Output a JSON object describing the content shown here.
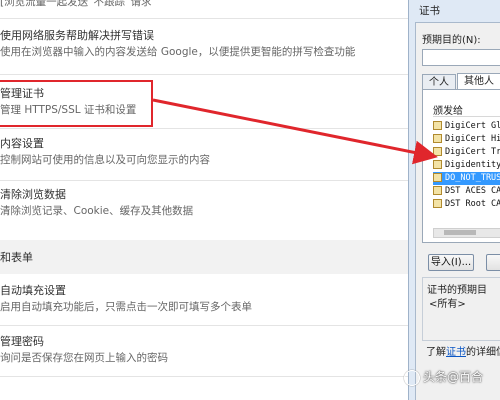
{
  "settings": {
    "top_fragment": "[浏览流量一起发送“不跟踪”请求",
    "spell": {
      "title": "使用网络服务帮助解决拼写错误",
      "desc": "使用在浏览器中输入的内容发送给 Google，以便提供更智能的拼写检查功能"
    },
    "certs": {
      "title": "管理证书",
      "desc": "管理 HTTPS/SSL 证书和设置"
    },
    "content": {
      "title": "内容设置",
      "desc": "控制网站可使用的信息以及可向您显示的内容"
    },
    "clear": {
      "title": "清除浏览数据",
      "desc": "清除浏览记录、Cookie、缓存及其他数据"
    },
    "forms_section": "和表单",
    "autofill": {
      "title": "自动填充设置",
      "desc": "启用自动填充功能后，只需点击一次即可填写多个表单"
    },
    "passwords": {
      "title": "管理密码",
      "desc": "询问是否保存您在网页上输入的密码"
    }
  },
  "dialog": {
    "title": "证书",
    "purpose_label": "预期目的(N):",
    "tabs": [
      "个人",
      "其他人"
    ],
    "column_issued_to": "颁发给",
    "certificates": [
      "DigiCert Gl",
      "DigiCert Hi",
      "DigiCert Tr",
      "Digidentity",
      "DO_NOT_TRUS",
      "DST ACES CA",
      "DST Root CA"
    ],
    "selected_index": 4,
    "import_button": "导入(I)...",
    "export_button": "导",
    "purpose_group_label": "证书的预期目",
    "purpose_group_value": "<所有>",
    "learn_more_prefix": "了解",
    "learn_more_link": "证书",
    "learn_more_suffix": "的详细信"
  },
  "watermark": "头条@百合",
  "colors": {
    "highlight": "#e0262c",
    "selection": "#3399ff",
    "link": "#0b56c4"
  }
}
